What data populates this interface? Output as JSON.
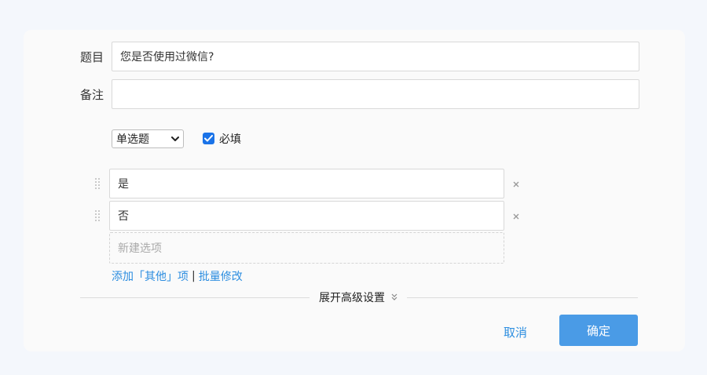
{
  "form": {
    "title_label": "题目",
    "title_value": "您是否使用过微信?",
    "note_label": "备注",
    "note_value": "",
    "question_type": "单选题",
    "required_label": "必填",
    "required_checked": true
  },
  "options": [
    {
      "label": "是"
    },
    {
      "label": "否"
    }
  ],
  "new_option_placeholder": "新建选项",
  "links": {
    "add_other": "添加「其他」项",
    "separator": "|",
    "batch_edit": "批量修改"
  },
  "advanced_label": "展开高级设置",
  "buttons": {
    "cancel": "取消",
    "confirm": "确定"
  },
  "colors": {
    "accent": "#2d8ee0",
    "confirm_bg": "#4a9be6",
    "checkbox": "#1a73e8"
  },
  "icons": {
    "drag": "drag-handle-icon",
    "remove": "close-icon",
    "select_chevron": "chevron-down-icon",
    "advanced": "double-chevron-down-icon"
  }
}
